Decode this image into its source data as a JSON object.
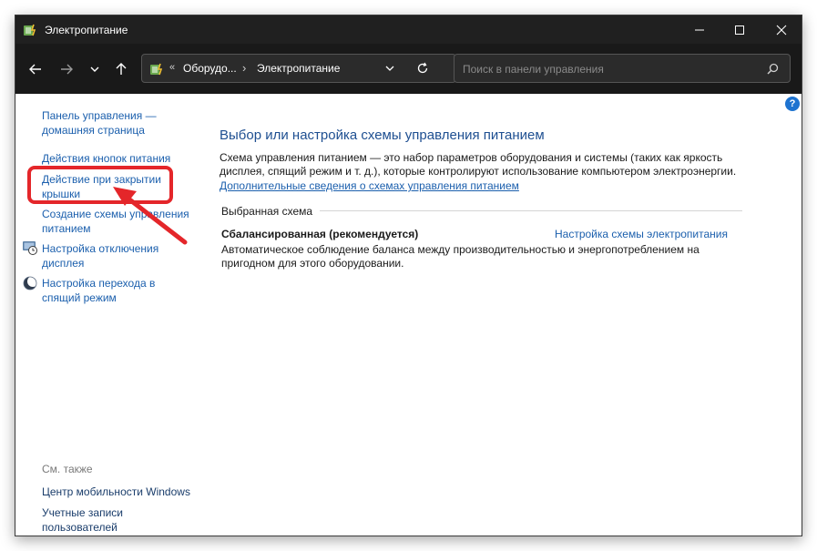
{
  "window": {
    "title": "Электропитание",
    "buttons": {
      "minimize": "minimize",
      "maximize": "maximize",
      "close": "close"
    }
  },
  "navbar": {
    "breadcrumb_prefix": "«",
    "breadcrumb": [
      "Оборудо...",
      "Электропитание"
    ],
    "breadcrumb_separator": "›",
    "search_placeholder": "Поиск в панели управления"
  },
  "sidebar": {
    "items": [
      {
        "label": "Панель управления — домашняя страница",
        "line1": "Панель управления —",
        "line2": "домашняя страница"
      },
      {
        "label": "Действия кнопок питания",
        "line1": "Действия кнопок питания",
        "line2": ""
      },
      {
        "label": "Действие при закрытии крышки",
        "line1": "Действие при закрытии",
        "line2": "крышки"
      },
      {
        "label": "Создание схемы управления питанием",
        "line1": "Создание схемы управления",
        "line2": "питанием"
      },
      {
        "label": "Настройка отключения дисплея",
        "line1": "Настройка отключения",
        "line2": "дисплея"
      },
      {
        "label": "Настройка перехода в спящий режим",
        "line1": "Настройка перехода в",
        "line2": "спящий режим"
      }
    ],
    "see_also": "См. также",
    "see_also_links": [
      {
        "line1": "Центр мобильности Windows",
        "line2": ""
      },
      {
        "line1": "Учетные записи",
        "line2": "пользователей"
      }
    ]
  },
  "main": {
    "title": "Выбор или настройка схемы управления питанием",
    "description_line1": "Схема управления питанием — это набор параметров оборудования и системы (таких как яркость",
    "description_line2": "дисплея, спящий режим и т. д.), которые контролируют использование компьютером электроэнергии.",
    "more_info_link": "Дополнительные сведения о схемах управления питанием",
    "selected_plan_label": "Выбранная схема",
    "plan_name": "Сбалансированная (рекомендуется)",
    "plan_settings_link": "Настройка схемы электропитания",
    "plan_description_line1": "Автоматическое соблюдение баланса между производительностью и энергопотреблением на",
    "plan_description_line2": "пригодном для этого оборудовании.",
    "help_glyph": "?"
  },
  "colors": {
    "titlebar": "#202020",
    "navbar": "#191919",
    "link": "#1b5fad",
    "title": "#1e4f91",
    "annotation": "#e4262a"
  }
}
